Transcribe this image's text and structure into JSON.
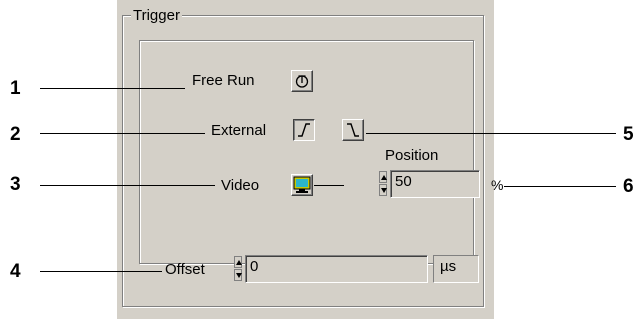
{
  "trigger_group": {
    "title": "Trigger",
    "free_run": {
      "label": "Free Run",
      "icon": "free-run-icon"
    },
    "external": {
      "label": "External",
      "rising_icon": "rising-edge-icon",
      "falling_icon": "falling-edge-icon"
    },
    "video": {
      "label": "Video",
      "icon": "video-monitor-icon"
    },
    "position": {
      "label": "Position",
      "value": "50",
      "unit": "%"
    }
  },
  "offset": {
    "label": "Offset",
    "value": "0",
    "unit": "µs"
  },
  "callouts": [
    "1",
    "2",
    "3",
    "4",
    "5",
    "6"
  ],
  "colors": {
    "panel": "#d4d0c8",
    "monitor_screen": "#2bb5c9",
    "monitor_body": "#c8c800"
  }
}
